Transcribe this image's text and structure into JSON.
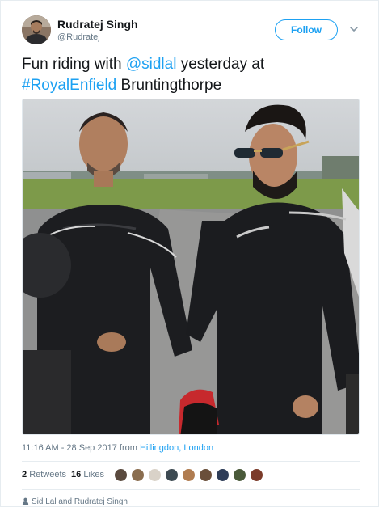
{
  "user": {
    "name": "Rudratej Singh",
    "handle": "@Rudratej",
    "follow_label": "Follow"
  },
  "tweet": {
    "text_prefix": "Fun riding with ",
    "mention": "@sidlal",
    "text_middle": " yesterday at",
    "hashtag": "#RoyalEnfield",
    "text_suffix": " Bruntingthorpe"
  },
  "meta": {
    "time": "11:16 AM - 28 Sep 2017 from ",
    "location": "Hillingdon, London"
  },
  "stats": {
    "retweets_count": "2",
    "retweets_label": "Retweets",
    "likes_count": "16",
    "likes_label": "Likes"
  },
  "liker_colors": [
    "#5a4a3e",
    "#8a6d4f",
    "#d9d2c8",
    "#3d4a52",
    "#b07c50",
    "#6a4f3a",
    "#2e3d58",
    "#4a5a3a",
    "#7b3b2a"
  ],
  "footer": {
    "text": "Sid Lal and Rudratej Singh"
  },
  "colors": {
    "accent": "#1da1f2",
    "secondary_text": "#657786",
    "primary_text": "#14171a"
  },
  "icons": {
    "more": "chevron-down-icon",
    "people": "person-icon"
  }
}
